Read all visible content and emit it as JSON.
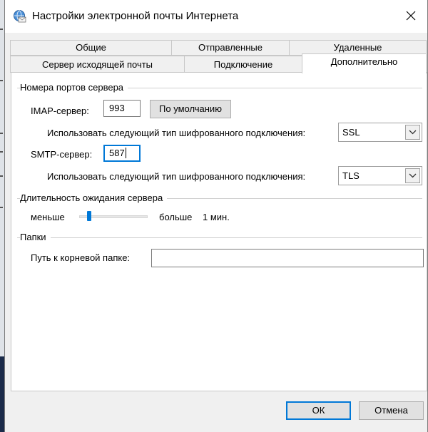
{
  "window": {
    "title": "Настройки электронной почты Интернета",
    "close_glyph": "✕"
  },
  "tabs": {
    "row1": [
      {
        "label": "Общие",
        "active": false
      },
      {
        "label": "Отправленные",
        "active": false
      },
      {
        "label": "Удаленные",
        "active": false
      }
    ],
    "row2": [
      {
        "label": "Сервер исходящей почты",
        "active": false
      },
      {
        "label": "Подключение",
        "active": false
      },
      {
        "label": "Дополнительно",
        "active": true
      }
    ]
  },
  "ports": {
    "group_title": "Номера портов сервера",
    "imap_label": "IMAP-сервер:",
    "imap_value": "993",
    "default_button": "По умолчанию",
    "imap_encryption_label": "Использовать следующий тип шифрованного подключения:",
    "imap_encryption_value": "SSL",
    "smtp_label": "SMTP-сервер:",
    "smtp_value": "587",
    "smtp_encryption_label": "Использовать следующий тип шифрованного подключения:",
    "smtp_encryption_value": "TLS"
  },
  "timeout": {
    "group_title": "Длительность ожидания сервера",
    "less_label": "меньше",
    "more_label": "больше",
    "value_text": "1 мин.",
    "slider_fraction": 0.12
  },
  "folders": {
    "group_title": "Папки",
    "root_path_label": "Путь к корневой папке:",
    "root_path_value": ""
  },
  "footer": {
    "ok_label": "ОК",
    "cancel_label": "Отмена"
  },
  "icons": {
    "title": "globe-mail-icon",
    "close": "close-icon",
    "dropdown": "chevron-down-icon"
  },
  "colors": {
    "accent": "#0078d7"
  }
}
